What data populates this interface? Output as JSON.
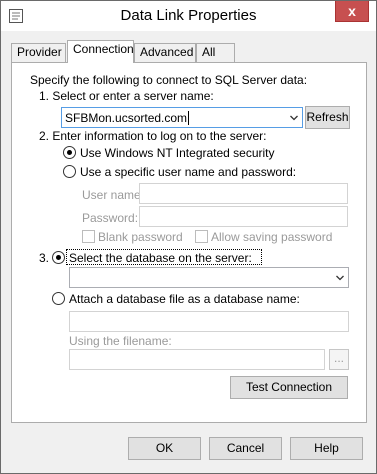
{
  "window": {
    "title": "Data Link Properties",
    "close_glyph": "x"
  },
  "tabs": [
    {
      "label": "Provider"
    },
    {
      "label": "Connection"
    },
    {
      "label": "Advanced"
    },
    {
      "label": "All"
    }
  ],
  "connection": {
    "intro": "Specify the following to connect to SQL Server data:",
    "step1_label": "1. Select or enter a server name:",
    "server_name_value": "SFBMon.ucsorted.com",
    "refresh_label": "Refresh",
    "step2_label": "2. Enter information to log on to the server:",
    "radio_nt_security": "Use Windows NT Integrated security",
    "radio_specific_user": "Use a specific user name and password:",
    "username_label": "User name:",
    "username_value": "",
    "password_label": "Password:",
    "password_value": "",
    "blank_password_label": "Blank password",
    "allow_saving_label": "Allow saving password",
    "step3_prefix": "3.",
    "radio_select_db": "Select the database on the server:",
    "database_value": "",
    "radio_attach_db": "Attach a database file as a database name:",
    "attach_name_value": "",
    "using_filename_label": "Using the filename:",
    "filename_value": "",
    "browse_label": "...",
    "test_connection_label": "Test Connection"
  },
  "footer": {
    "ok_label": "OK",
    "cancel_label": "Cancel",
    "help_label": "Help"
  },
  "state": {
    "use_nt_security": true,
    "select_database": true,
    "blank_password": false,
    "allow_saving_password": false
  }
}
